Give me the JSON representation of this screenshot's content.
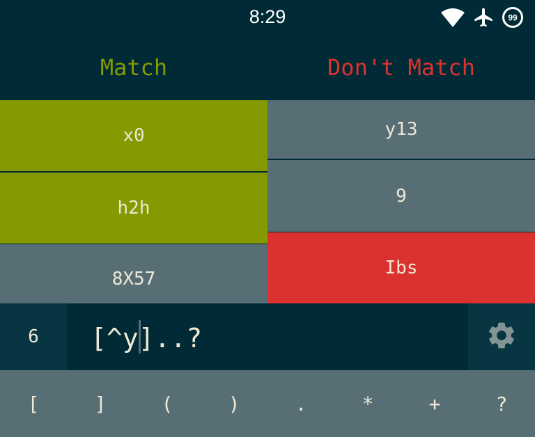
{
  "status_bar": {
    "time": "8:29",
    "icons": [
      "wifi-icon",
      "airplane-mode-icon",
      "battery-icon"
    ],
    "battery_level": "99"
  },
  "header": {
    "match_label": "Match",
    "dont_match_label": "Don't Match"
  },
  "colors": {
    "background": "#002b36",
    "panel": "#073642",
    "neutral_cell": "#586e75",
    "match_green": "#859900",
    "fail_red": "#dc322f",
    "text": "#eee8d5"
  },
  "match_list": [
    {
      "text": "x0",
      "state": "matched"
    },
    {
      "text": "h2h",
      "state": "matched"
    },
    {
      "text": "8X57",
      "state": "neutral"
    }
  ],
  "dont_match_list": [
    {
      "text": "y13",
      "state": "neutral"
    },
    {
      "text": "9",
      "state": "neutral"
    },
    {
      "text": "Ibs",
      "state": "wrongly_matched"
    }
  ],
  "input": {
    "level": "6",
    "regex": "[^y]..?",
    "settings_icon": "gear-icon"
  },
  "keyboard": {
    "keys": [
      "[",
      "]",
      "(",
      ")",
      ".",
      "*",
      "+",
      "?"
    ]
  }
}
